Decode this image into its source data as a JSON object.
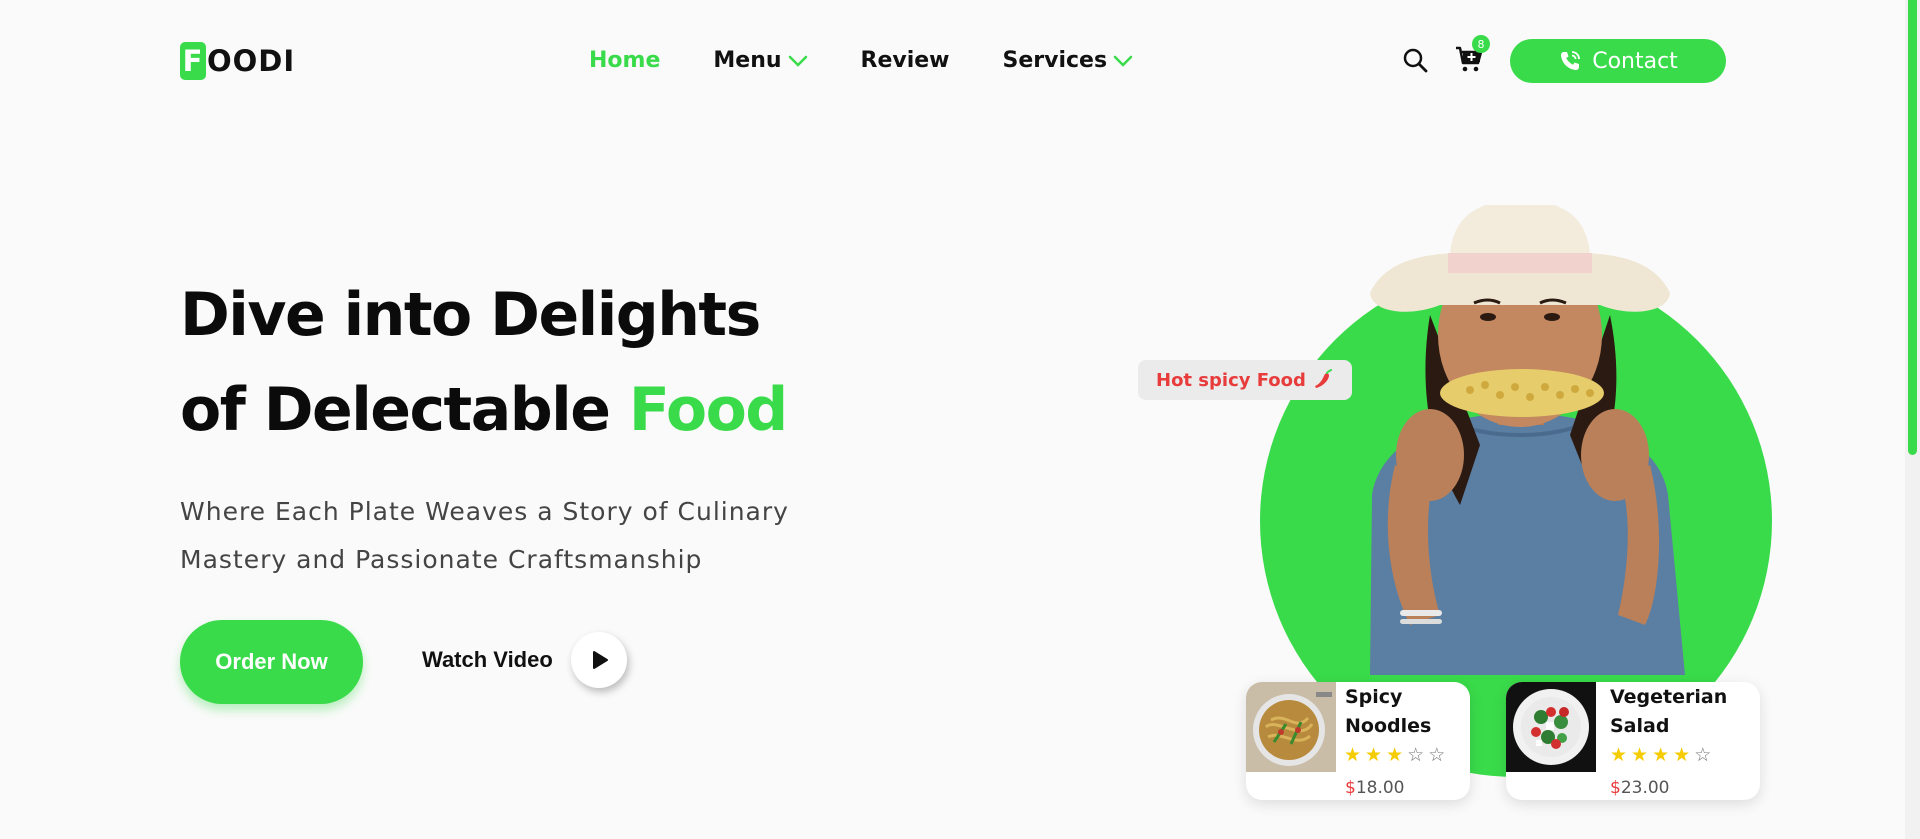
{
  "nav": {
    "logo_letter": "F",
    "logo_rest": "OODI",
    "menu": [
      {
        "label": "Home",
        "active": true,
        "dropdown": false
      },
      {
        "label": "Menu",
        "active": false,
        "dropdown": true
      },
      {
        "label": "Review",
        "active": false,
        "dropdown": false
      },
      {
        "label": "Services",
        "active": false,
        "dropdown": true
      }
    ],
    "cart_count": "8",
    "contact_label": "Contact",
    "icons": {
      "search": "search-icon",
      "cart": "cart-icon",
      "phone": "phone-icon",
      "dropdown": "chevron-down-icon"
    }
  },
  "hero": {
    "headline_line1": "Dive into Delights",
    "headline_line2_prefix": "of Delectable ",
    "headline_highlight": "Food",
    "subtitle_line1": "Where Each Plate Weaves a Story of Culinary",
    "subtitle_line2": "Mastery and Passionate Craftsmanship",
    "order_label": "Order Now",
    "watch_label": "Watch Video",
    "tag_label": "Hot spicy Food",
    "tag_icon": "chili-pepper-icon"
  },
  "cards": [
    {
      "name": "Spicy Noodles",
      "rating": 3,
      "max": 5,
      "currency": "$",
      "price": "18.00"
    },
    {
      "name": "Vegeterian Salad",
      "rating": 4,
      "max": 5,
      "currency": "$",
      "price": "23.00"
    }
  ],
  "colors": {
    "accent": "#39db4a",
    "price_symbol": "#e83b3b",
    "star": "#f5cc00"
  }
}
